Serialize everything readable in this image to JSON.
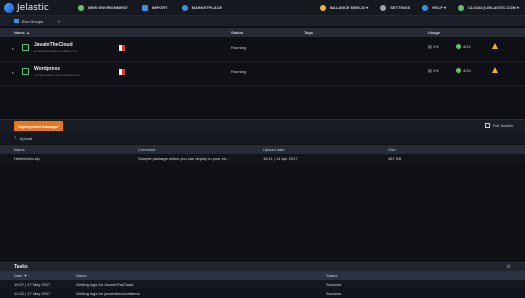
{
  "app": {
    "logo_text": "Jelastic"
  },
  "topbar": {
    "new_environment": "NEW ENVIRONMENT",
    "import": "IMPORT",
    "marketplace": "MARKETPLACE",
    "balance": "BALANCE $959.22 ▾",
    "settings": "SETTINGS",
    "help": "HELP ▾",
    "account": "CLOUD@JELASTIC.COM ▾"
  },
  "envbar": {
    "env_groups": "Env Groups"
  },
  "grid": {
    "headers": {
      "name": "Name ▲",
      "status": "Status",
      "tags": "Tags",
      "usage": "Usage"
    },
    "rows": [
      {
        "name": "JavaInTheCloud",
        "url": "javaintheclouddemo.jelastic.com",
        "status": "Running",
        "usage_cpu": "1%",
        "usage_nodes": "4/12"
      },
      {
        "name": "Wordpress",
        "url": "wordpressdemo.demo.jelastic.com",
        "status": "Running",
        "usage_cpu": "1%",
        "usage_nodes": "4/10"
      }
    ]
  },
  "deployment": {
    "tab_label": "Deployment manager",
    "fullscreen_label": "Full Screen",
    "upload_label": "Upload",
    "headers": {
      "name": "Name",
      "comment": "Comment",
      "upload_date": "Upload date",
      "size": "Size"
    },
    "rows": [
      {
        "name": "HelloWorld.zip",
        "comment": "Sample package which you can deploy to your en...",
        "upload_date": "18:11 | 14 Apr 2017",
        "size": "487 KB"
      }
    ]
  },
  "tasks": {
    "title": "Tasks",
    "headers": {
      "date": "Date ▼",
      "name": "Name",
      "status": "Status"
    },
    "rows": [
      {
        "date": "10:27 | 17 May 2017",
        "name": "Getting logs for JavaInTheCloud",
        "status": "Success"
      },
      {
        "date": "10:22 | 17 May 2017",
        "name": "Getting logs for javaintheclouddemo",
        "status": "Success"
      }
    ]
  },
  "colors": {
    "accent_orange": "#e3781d",
    "running_green": "#5ec46f",
    "warning_yellow": "#f0b429",
    "background": "#0e1015"
  },
  "icons": [
    "jelastic-logo-icon",
    "new-env-icon",
    "import-icon",
    "marketplace-icon",
    "balance-icon",
    "settings-icon",
    "help-icon",
    "account-icon",
    "env-groups-icon",
    "node-icon",
    "flag-icon",
    "cpu-icon",
    "nodes-icon",
    "warning-icon",
    "fullscreen-icon",
    "upload-icon",
    "tasks-tool-icon"
  ]
}
